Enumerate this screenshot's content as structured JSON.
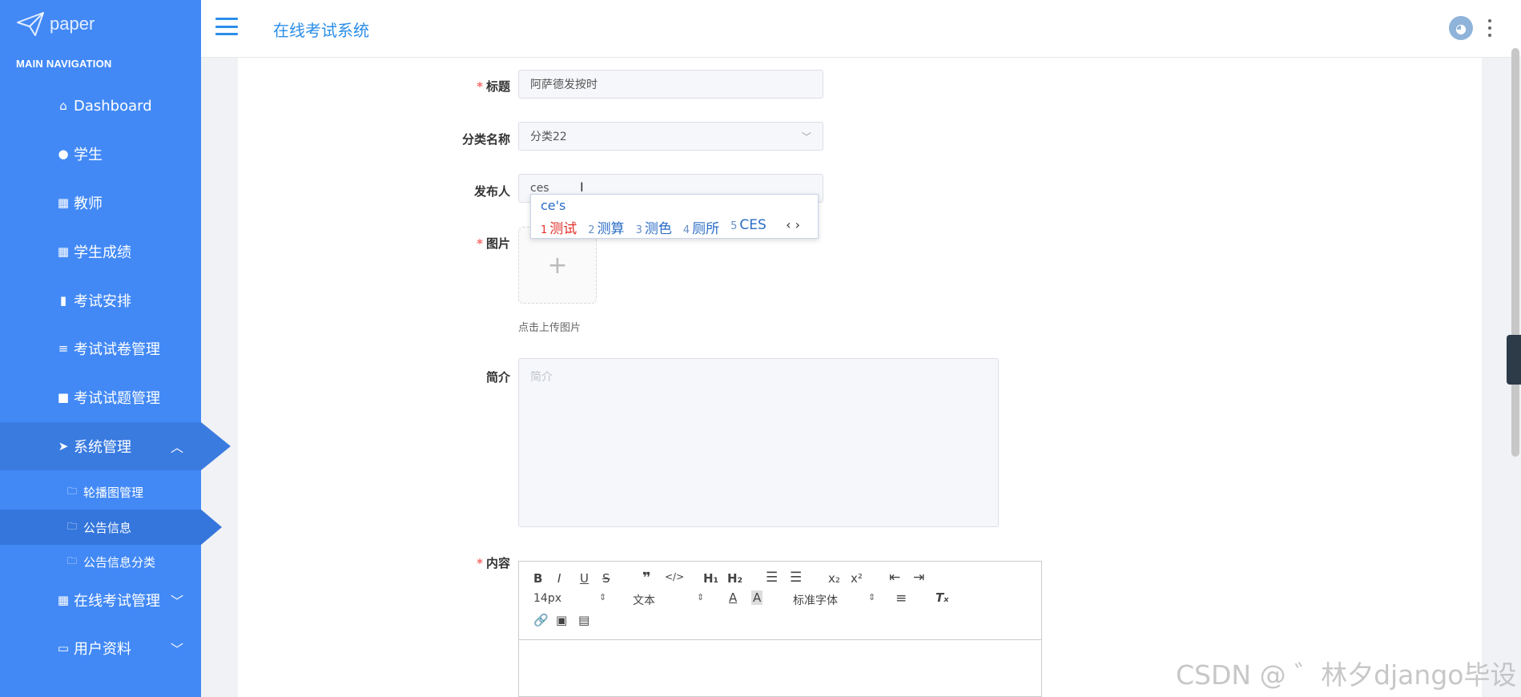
{
  "logo": {
    "text": "paper"
  },
  "sidebar": {
    "heading": "MAIN NAVIGATION",
    "items": [
      {
        "label": "Dashboard",
        "icon": "home-icon"
      },
      {
        "label": "学生",
        "icon": "bulb-icon"
      },
      {
        "label": "教师",
        "icon": "grid-icon"
      },
      {
        "label": "学生成绩",
        "icon": "grid-icon"
      },
      {
        "label": "考试安排",
        "icon": "book-icon"
      },
      {
        "label": "考试试卷管理",
        "icon": "list-icon"
      },
      {
        "label": "考试试题管理",
        "icon": "briefcase-icon"
      },
      {
        "label": "系统管理",
        "icon": "send-icon",
        "expanded": true
      },
      {
        "label": "在线考试管理",
        "icon": "table-icon"
      },
      {
        "label": "用户资料",
        "icon": "card-icon"
      }
    ],
    "sub_items": [
      {
        "label": "轮播图管理"
      },
      {
        "label": "公告信息",
        "active": true
      },
      {
        "label": "公告信息分类"
      }
    ]
  },
  "header": {
    "title": "在线考试系统"
  },
  "form": {
    "title_label": "标题",
    "title_value": "阿萨德发按时",
    "category_label": "分类名称",
    "category_value": "分类22",
    "publisher_label": "发布人",
    "publisher_value": "ces",
    "image_label": "图片",
    "upload_hint": "点击上传图片",
    "intro_label": "简介",
    "intro_placeholder": "简介",
    "content_label": "内容"
  },
  "ime": {
    "composition": "ce's",
    "candidates": [
      {
        "num": "1",
        "text": "测试"
      },
      {
        "num": "2",
        "text": "测算"
      },
      {
        "num": "3",
        "text": "测色"
      },
      {
        "num": "4",
        "text": "厕所"
      },
      {
        "num": "5",
        "text": "CES"
      }
    ],
    "nav": "‹ ›"
  },
  "editor": {
    "font_size": "14px",
    "block_format": "文本",
    "font_family": "标准字体"
  },
  "watermark": "CSDN @ ゛林夕django毕设",
  "colors": {
    "sidebar": "#4289f6",
    "accent": "#2b8ee8",
    "required": "#f56c6c"
  }
}
